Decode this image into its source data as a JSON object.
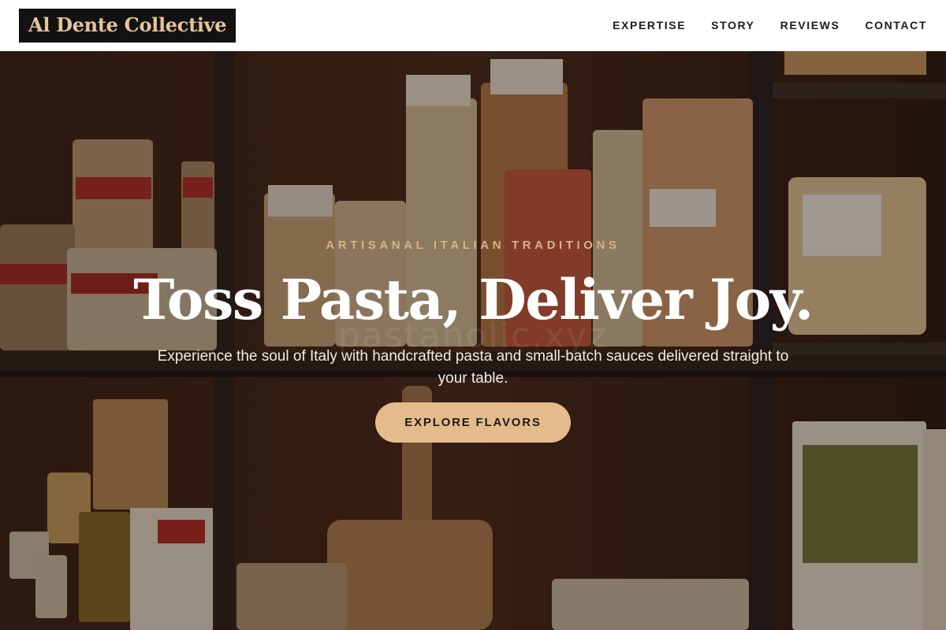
{
  "brand": {
    "logo_text": "Al Dente Collective"
  },
  "nav": {
    "items": [
      {
        "label": "EXPERTISE"
      },
      {
        "label": "STORY"
      },
      {
        "label": "REVIEWS"
      },
      {
        "label": "CONTACT"
      }
    ]
  },
  "hero": {
    "eyebrow": "ARTISANAL ITALIAN TRADITIONS",
    "headline": "Toss Pasta, Deliver Joy.",
    "subtext": "Experience the soul of Italy with handcrafted pasta and small-batch sauces delivered straight to your table.",
    "cta_label": "EXPLORE FLAVORS",
    "watermark": "pastaholic.xyz",
    "background_image": "pasta-shop-shelves-photo"
  },
  "colors": {
    "accent": "#e4bb8b",
    "logo_bg": "#121212",
    "logo_text": "#e8c39a",
    "eyebrow": "#d8b282"
  }
}
